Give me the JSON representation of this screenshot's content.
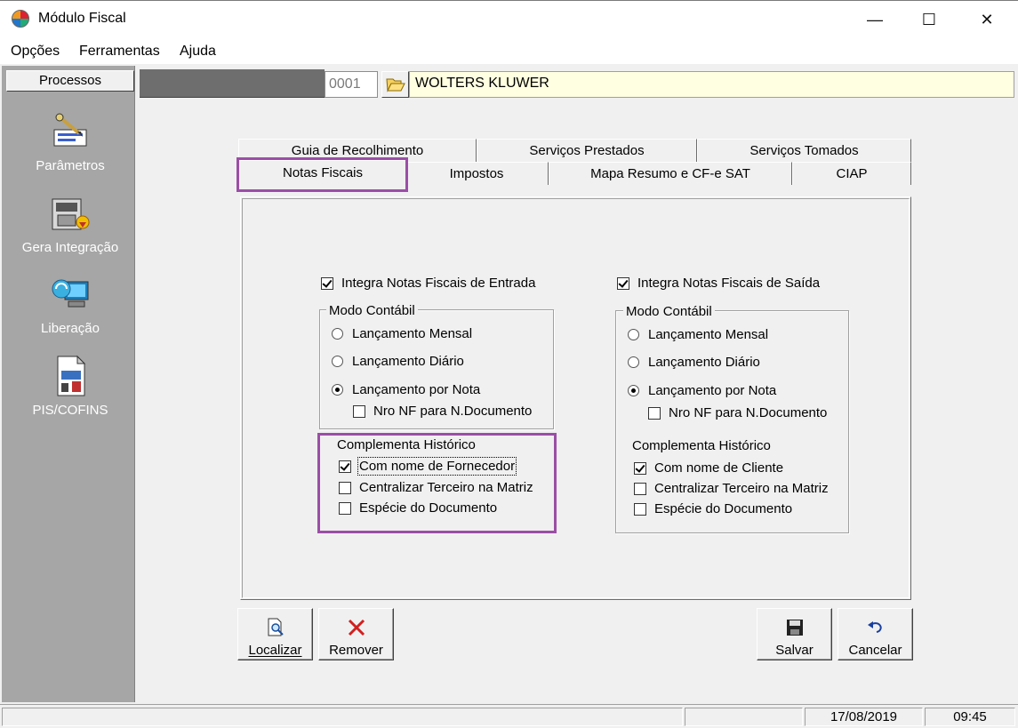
{
  "window": {
    "title": "Módulo Fiscal",
    "minimize_symbol": "—",
    "maximize_symbol": "☐",
    "close_symbol": "✕"
  },
  "menu": [
    "Opções",
    "Ferramentas",
    "Ajuda"
  ],
  "sidebar": {
    "header": "Processos",
    "items": [
      {
        "label": "Parâmetros",
        "icon": "parameters-icon"
      },
      {
        "label": "Gera Integração",
        "icon": "integration-icon"
      },
      {
        "label": "Liberação",
        "icon": "release-icon"
      },
      {
        "label": "PIS/COFINS",
        "icon": "pis-cofins-icon"
      }
    ]
  },
  "company": {
    "code": "0001",
    "name": "WOLTERS KLUWER"
  },
  "tabs": {
    "row1": [
      "Guia de Recolhimento",
      "Serviços Prestados",
      "Serviços Tomados"
    ],
    "row2": [
      "Notas Fiscais",
      "Impostos",
      "Mapa Resumo e CF-e SAT",
      "CIAP"
    ],
    "active": "Notas Fiscais"
  },
  "entrada": {
    "integra_label": "Integra Notas Fiscais de Entrada",
    "integra_checked": true,
    "modo_title": "Modo Contábil",
    "radios": [
      "Lançamento Mensal",
      "Lançamento Diário",
      "Lançamento por Nota"
    ],
    "selected_radio": "Lançamento por Nota",
    "nro_nf_label": "Nro NF para N.Documento",
    "nro_nf_checked": false,
    "complementa_title": "Complementa Histórico",
    "options": [
      {
        "label": "Com nome de Fornecedor",
        "checked": true
      },
      {
        "label": "Centralizar Terceiro na Matriz",
        "checked": false
      },
      {
        "label": "Espécie do Documento",
        "checked": false
      }
    ]
  },
  "saida": {
    "integra_label": "Integra Notas Fiscais de Saída",
    "integra_checked": true,
    "modo_title": "Modo Contábil",
    "radios": [
      "Lançamento Mensal",
      "Lançamento Diário",
      "Lançamento por Nota"
    ],
    "selected_radio": "Lançamento por Nota",
    "nro_nf_label": "Nro NF para N.Documento",
    "nro_nf_checked": false,
    "complementa_title": "Complementa Histórico",
    "options": [
      {
        "label": "Com nome de Cliente",
        "checked": true
      },
      {
        "label": "Centralizar Terceiro na Matriz",
        "checked": false
      },
      {
        "label": "Espécie do Documento",
        "checked": false
      }
    ]
  },
  "buttons": {
    "localizar": "Localizar",
    "remover": "Remover",
    "salvar": "Salvar",
    "cancelar": "Cancelar"
  },
  "status": {
    "date": "17/08/2019",
    "time": "09:45"
  },
  "colors": {
    "highlight": "#9b4ea6",
    "sidebar_bg": "#a6a6a6",
    "company_bg": "#ffffe1"
  }
}
